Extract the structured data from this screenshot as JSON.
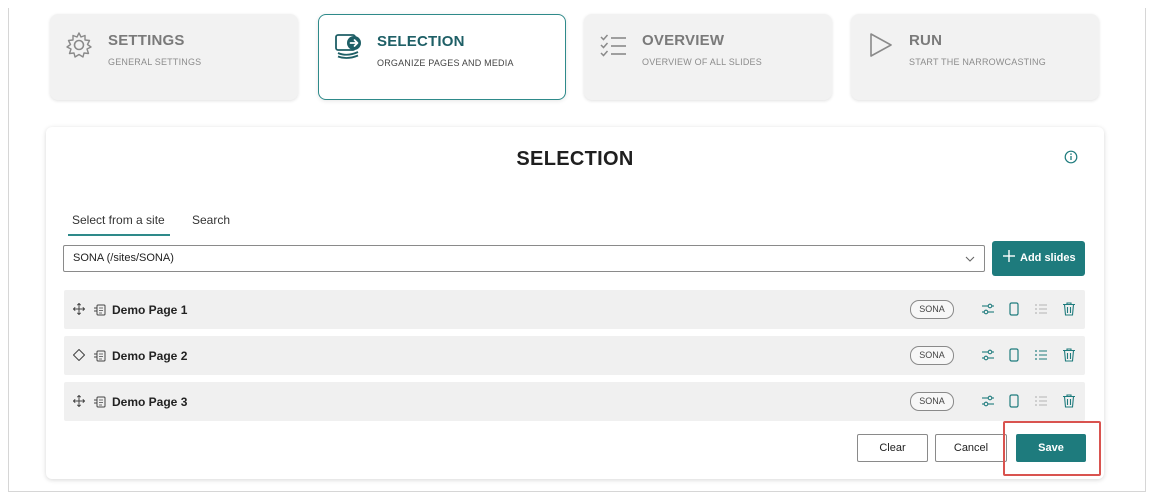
{
  "steps": [
    {
      "title": "SETTINGS",
      "subtitle": "GENERAL SETTINGS",
      "icon": "gear-icon",
      "active": false
    },
    {
      "title": "SELECTION",
      "subtitle": "ORGANIZE PAGES AND MEDIA",
      "icon": "selection-icon",
      "active": true
    },
    {
      "title": "OVERVIEW",
      "subtitle": "OVERVIEW OF ALL SLIDES",
      "icon": "checklist-icon",
      "active": false
    },
    {
      "title": "RUN",
      "subtitle": "START THE NARROWCASTING",
      "icon": "play-icon",
      "active": false
    }
  ],
  "panel": {
    "title": "SELECTION",
    "tabs": [
      {
        "label": "Select from a site",
        "active": true
      },
      {
        "label": "Search",
        "active": false
      }
    ],
    "site_value": "SONA (/sites/SONA)",
    "add_slides_label": "Add slides",
    "pages": [
      {
        "name": "Demo Page 1",
        "tag": "SONA"
      },
      {
        "name": "Demo Page 2",
        "tag": "SONA"
      },
      {
        "name": "Demo Page 3",
        "tag": "SONA"
      }
    ],
    "clear_label": "Clear",
    "cancel_label": "Cancel",
    "save_label": "Save"
  },
  "colors": {
    "accent": "#1e7b7d",
    "highlight": "#d9534f",
    "row_bg": "#f0f0f0"
  }
}
